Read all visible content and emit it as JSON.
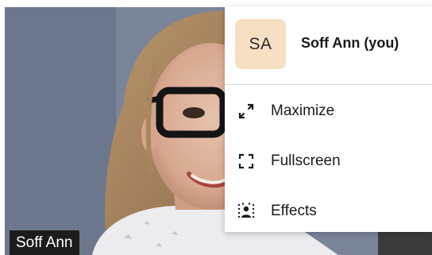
{
  "participant": {
    "name_tag": "Soff Ann"
  },
  "menu": {
    "avatar_initials": "SA",
    "avatar_color": "#f6dfc2",
    "user_name": "Soff Ann (you)",
    "items": [
      {
        "label": "Maximize",
        "icon": "maximize-icon"
      },
      {
        "label": "Fullscreen",
        "icon": "fullscreen-icon"
      },
      {
        "label": "Effects",
        "icon": "effects-icon"
      }
    ]
  }
}
